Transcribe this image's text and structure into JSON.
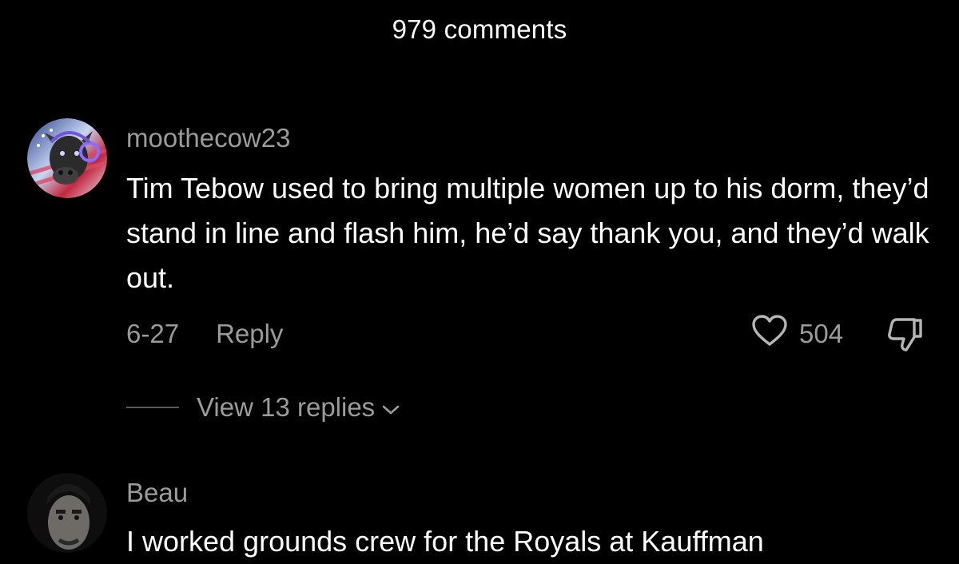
{
  "header": {
    "comment_count_label": "979 comments"
  },
  "comments": [
    {
      "username": "moothecow23",
      "text": "Tim Tebow used to bring multiple women up to his dorm, they’d stand in line and flash him, he’d say thank you, and they’d walk out.",
      "date": "6-27",
      "reply_label": "Reply",
      "likes": "504",
      "view_replies_label": "View 13 replies",
      "icons": {
        "like": "heart-icon",
        "dislike": "thumbs-down-icon",
        "expand": "chevron-down-icon"
      }
    },
    {
      "username": "Beau",
      "text": "I worked grounds crew for the Royals at Kauffman"
    }
  ],
  "colors": {
    "background": "#000000",
    "primary_text": "#ffffff",
    "secondary_text": "#9b9b9b"
  }
}
